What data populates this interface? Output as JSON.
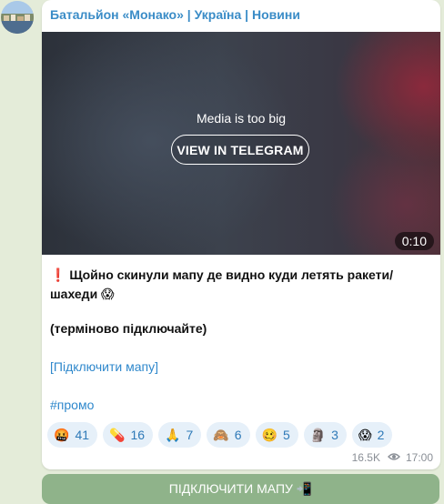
{
  "channel": {
    "name": "Батальйон «Монако» | Україна | Новини"
  },
  "media": {
    "note": "Media is too big",
    "view_button": "VIEW IN TELEGRAM",
    "duration": "0:10"
  },
  "post": {
    "line1": "❗ Щойно скинули мапу де видно куди летять ракети/шахеди 😱",
    "line2": "(терміново підключайте)",
    "link": "[Підключити мапу]",
    "hashtag": "#промо"
  },
  "reactions": [
    {
      "emoji": "🤬",
      "count": "41"
    },
    {
      "emoji": "💊",
      "count": "16"
    },
    {
      "emoji": "🙏",
      "count": "7"
    },
    {
      "emoji": "🙈",
      "count": "6"
    },
    {
      "emoji": "🥴",
      "count": "5"
    },
    {
      "emoji": "🗿",
      "count": "3"
    },
    {
      "emoji": "😱",
      "count": "2"
    }
  ],
  "meta": {
    "views": "16.5K",
    "time": "17:00"
  },
  "cta_button": {
    "label": "ПІДКЛЮЧИТИ МАПУ 📲"
  }
}
